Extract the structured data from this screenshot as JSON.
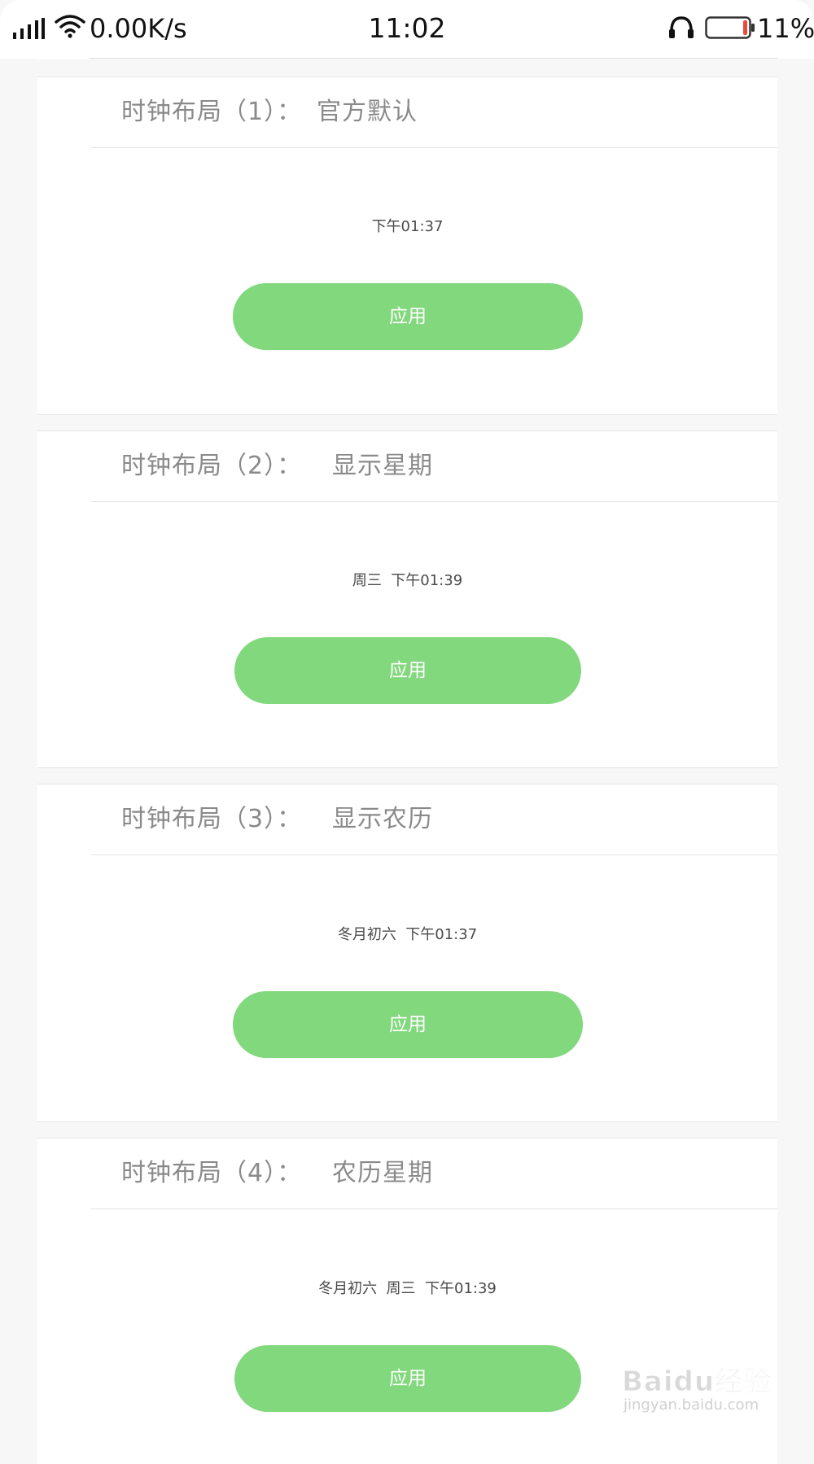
{
  "status_bar": {
    "network_speed": "0.00K/s",
    "time": "11:02",
    "battery_percent": "11%",
    "battery_level": 0.11,
    "battery_low_color": "#e84b3c"
  },
  "theme": {
    "accent": "#82d87d",
    "title_color": "#8a8a8a",
    "background": "#f7f7f7"
  },
  "layouts": [
    {
      "title": "时钟布局（1）：",
      "subtitle": "官方默认",
      "preview": "下午01:37",
      "button_label": "应用"
    },
    {
      "title": "时钟布局（2）：",
      "subtitle": "显示星期",
      "preview": "周三  下午01:39",
      "button_label": "应用"
    },
    {
      "title": "时钟布局（3）：",
      "subtitle": "显示农历",
      "preview": "冬月初六  下午01:37",
      "button_label": "应用"
    },
    {
      "title": "时钟布局（4）：",
      "subtitle": "农历星期",
      "preview": "冬月初六  周三  下午01:39",
      "button_label": "应用"
    }
  ],
  "watermark": {
    "logo": "Baidu经验",
    "url": "jingyan.baidu.com"
  }
}
